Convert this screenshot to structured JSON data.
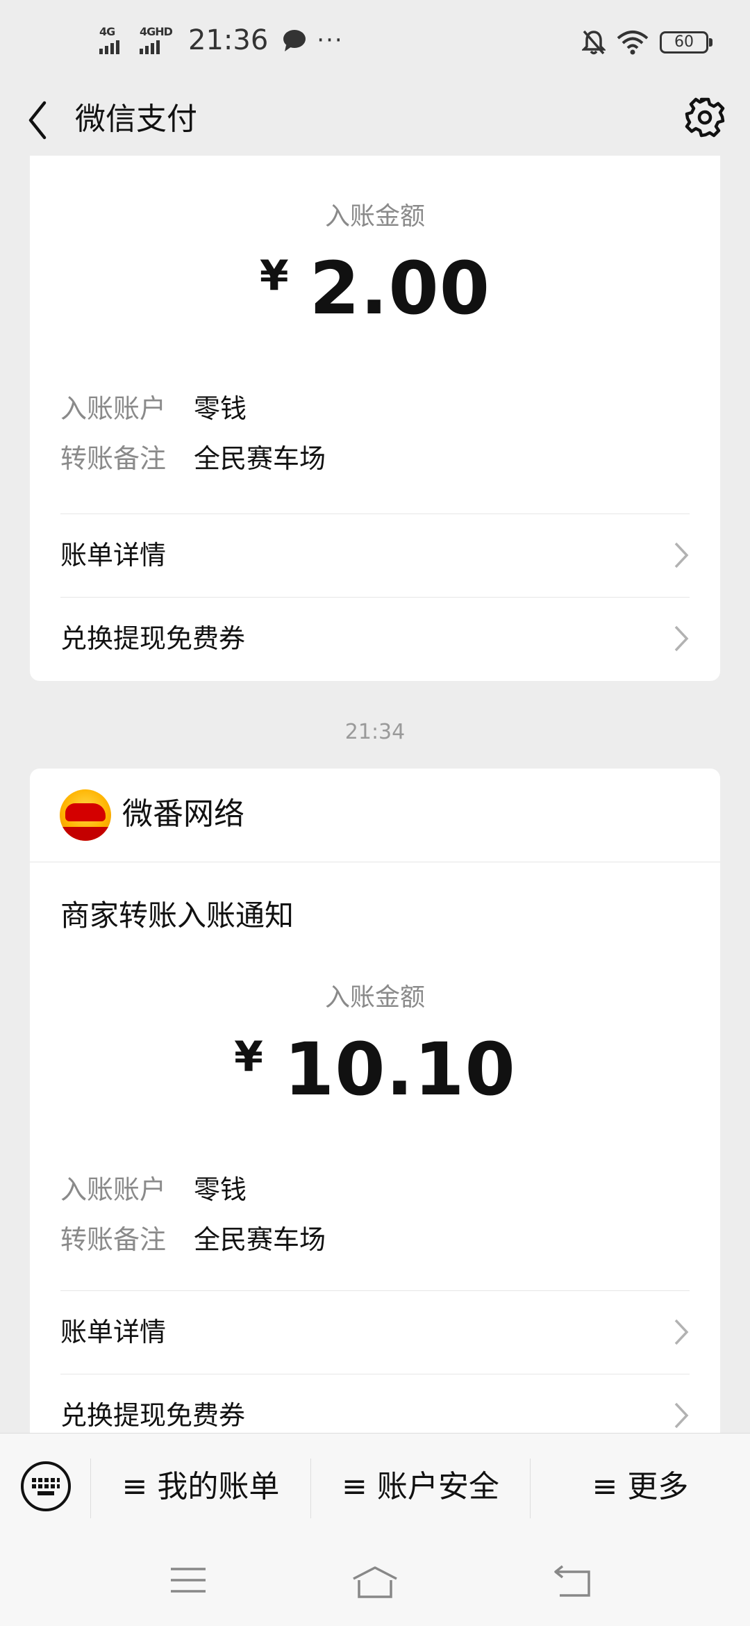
{
  "status_bar": {
    "network_1": "4G",
    "network_2": "4GHD",
    "time": "21:36",
    "more": "···",
    "battery": "60"
  },
  "nav": {
    "title": "微信支付"
  },
  "card_1": {
    "amount_label": "入账金额",
    "currency": "¥",
    "amount": "2.00",
    "account_label": "入账账户",
    "account_value": "零钱",
    "note_label": "转账备注",
    "note_value": "全民赛车场",
    "row_bill": "账单详情",
    "row_coupon": "兑换提现免费券"
  },
  "timestamp": "21:34",
  "card_2": {
    "merchant_name": "微番网络",
    "notice_title": "商家转账入账通知",
    "amount_label": "入账金额",
    "currency": "¥",
    "amount": "10.10",
    "account_label": "入账账户",
    "account_value": "零钱",
    "note_label": "转账备注",
    "note_value": "全民赛车场",
    "row_bill": "账单详情",
    "row_coupon": "兑换提现免费券"
  },
  "toolbar": {
    "my_bill": "≡ 我的账单",
    "account_security": "≡ 账户安全",
    "more": "≡ 更多"
  },
  "colors": {
    "background": "#ededed",
    "card": "#ffffff",
    "secondary_text": "#8a8a8a",
    "primary_text": "#111111"
  }
}
